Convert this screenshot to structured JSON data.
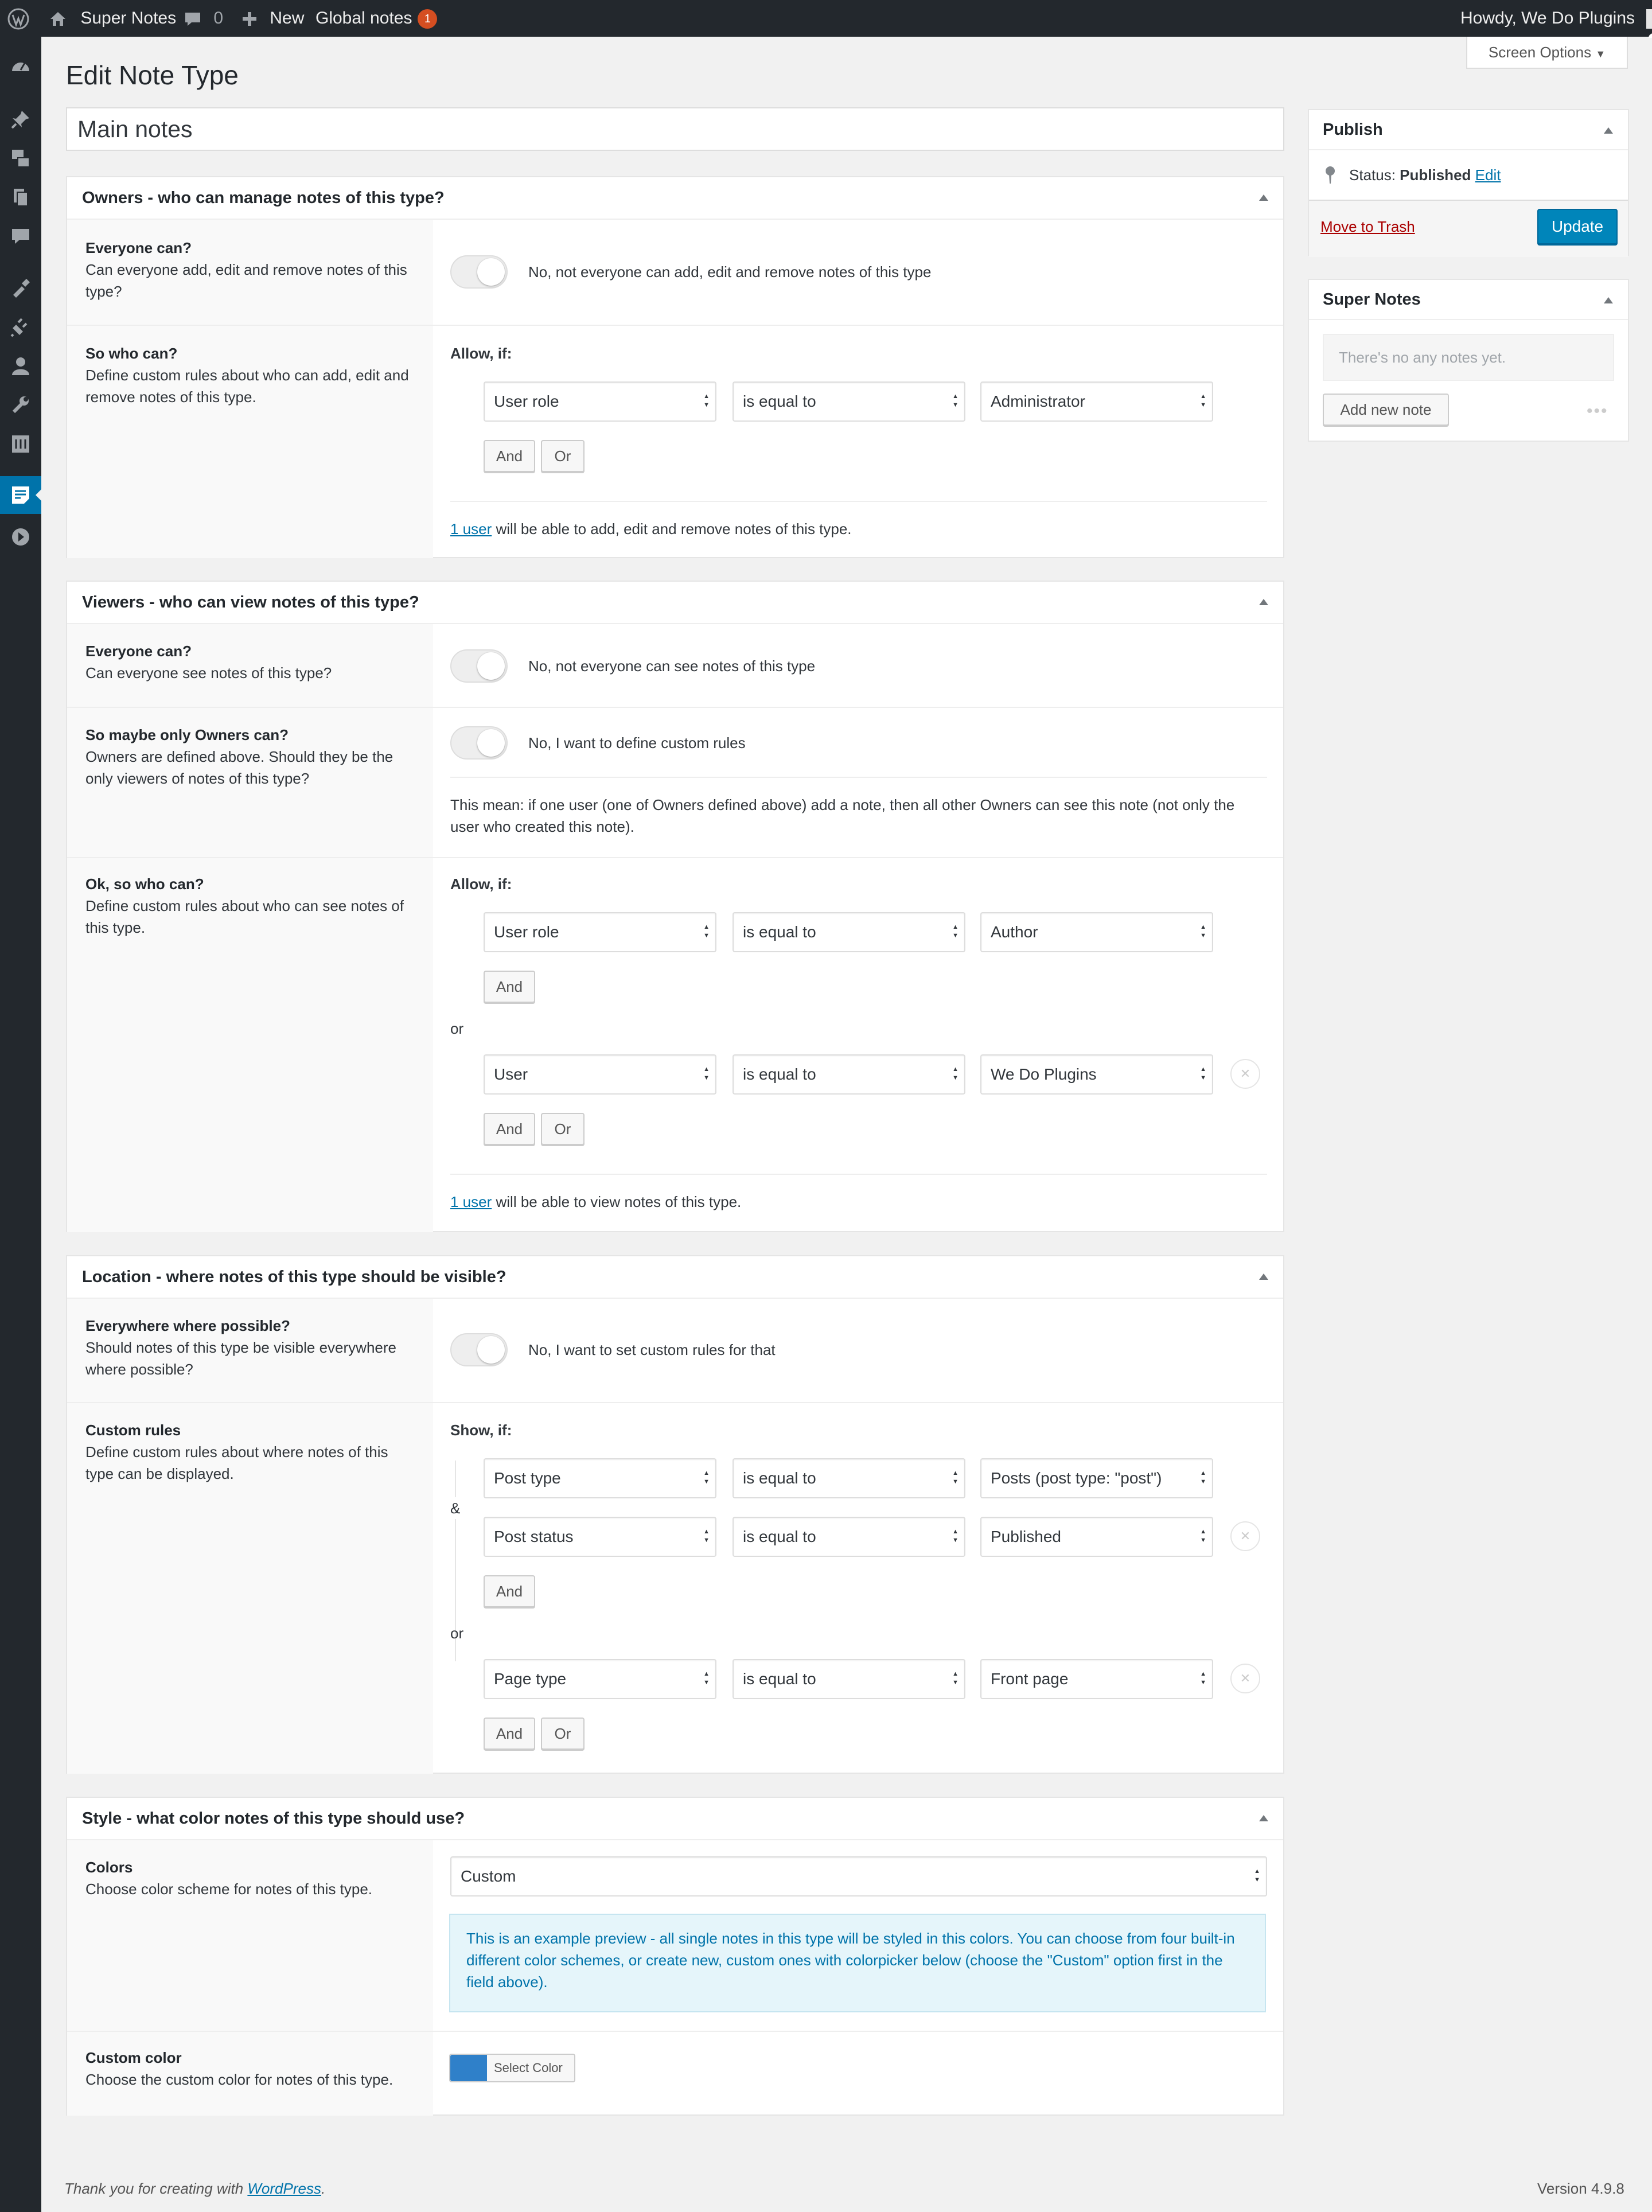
{
  "adminbar": {
    "site_name": "Super Notes",
    "comments_count": "0",
    "new_label": "New",
    "global_notes_label": "Global notes",
    "global_notes_badge": "1",
    "greeting": "Howdy, We Do Plugins"
  },
  "screen_options": "Screen Options",
  "page_title": "Edit Note Type",
  "post_title": "Main notes",
  "owners": {
    "heading": "Owners - who can manage notes of this type?",
    "everyone_title": "Everyone can?",
    "everyone_desc": "Can everyone add, edit and remove notes of this type?",
    "everyone_toggle_label": "No, not everyone can add, edit and remove notes of this type",
    "who_title": "So who can?",
    "who_desc": "Define custom rules about who can add, edit and remove notes of this type.",
    "allow_if": "Allow, if:",
    "rule": {
      "field": "User role",
      "op": "is equal to",
      "value": "Administrator"
    },
    "and_label": "And",
    "or_label": "Or",
    "summary_link": "1 user",
    "summary_text": " will be able to add, edit and remove notes of this type."
  },
  "viewers": {
    "heading": "Viewers - who can view notes of this type?",
    "everyone_title": "Everyone can?",
    "everyone_desc": "Can everyone see notes of this type?",
    "everyone_toggle_label": "No, not everyone can see notes of this type",
    "owners_title": "So maybe only Owners can?",
    "owners_desc": "Owners are defined above. Should they be the only viewers of notes of this type?",
    "owners_toggle_label": "No, I want to define custom rules",
    "owners_note": "This mean: if one user (one of Owners defined above) add a note, then all other Owners can see this note (not only the user who created this note).",
    "who_title": "Ok, so who can?",
    "who_desc": "Define custom rules about who can see notes of this type.",
    "allow_if": "Allow, if:",
    "rule1": {
      "field": "User role",
      "op": "is equal to",
      "value": "Author"
    },
    "or_word": "or",
    "rule2": {
      "field": "User",
      "op": "is equal to",
      "value": "We Do Plugins"
    },
    "and_label": "And",
    "or_label": "Or",
    "summary_link": "1 user",
    "summary_text": " will be able to view notes of this type."
  },
  "location": {
    "heading": "Location - where notes of this type should be visible?",
    "everywhere_title": "Everywhere where possible?",
    "everywhere_desc": "Should notes of this type be visible everywhere where possible?",
    "everywhere_toggle_label": "No, I want to set custom rules for that",
    "custom_title": "Custom rules",
    "custom_desc": "Define custom rules about where notes of this type can be displayed.",
    "show_if": "Show, if:",
    "amp": "&",
    "rule1": {
      "field": "Post type",
      "op": "is equal to",
      "value": "Posts (post type: \"post\")"
    },
    "rule2": {
      "field": "Post status",
      "op": "is equal to",
      "value": "Published"
    },
    "or_word": "or",
    "rule3": {
      "field": "Page type",
      "op": "is equal to",
      "value": "Front page"
    },
    "and_label": "And",
    "or_label": "Or"
  },
  "style": {
    "heading": "Style - what color notes of this type should use?",
    "colors_title": "Colors",
    "colors_desc": "Choose color scheme for notes of this type.",
    "scheme_value": "Custom",
    "preview_text": "This is an example preview - all single notes in this type will be styled in this colors. You can choose from four built-in different color schemes, or create new, custom ones with colorpicker below (choose the \"Custom\" option first in the field above).",
    "custom_title": "Custom color",
    "custom_desc": "Choose the custom color for notes of this type.",
    "swatch_color": "#2f80c9",
    "select_color_label": "Select Color"
  },
  "publish": {
    "heading": "Publish",
    "status_label": "Status:",
    "status_value": "Published",
    "edit_link": "Edit",
    "trash_link": "Move to Trash",
    "update_button": "Update"
  },
  "super_notes": {
    "heading": "Super Notes",
    "empty_text": "There's no any notes yet.",
    "add_button": "Add new note"
  },
  "footer": {
    "thanks_prefix": "Thank you for creating with ",
    "wp_link": "WordPress",
    "thanks_suffix": ".",
    "version": "Version 4.9.8"
  }
}
